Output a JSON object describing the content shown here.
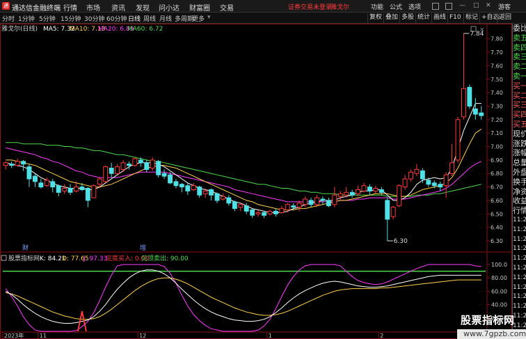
{
  "titlebar": {
    "app_name": "通达信金融终端",
    "menus": [
      "行情",
      "市场",
      "资讯",
      "发现",
      "问小达",
      "财富圈",
      "交易"
    ],
    "notice": "证券交易未登录",
    "stock_link": "雅戈尔",
    "right_items": [
      "功能",
      "公式",
      "选项"
    ],
    "guest": "游客"
  },
  "toolbar": {
    "periods": [
      "分时",
      "1分钟",
      "5分钟",
      "15分钟",
      "30分钟",
      "60分钟",
      "日线",
      "周线",
      "月线",
      "多周期",
      "更多"
    ],
    "active_period": "日线",
    "right_buttons": [
      "复权",
      "叠加",
      "多股",
      "统计",
      "画线",
      "F10",
      "标记",
      "+自选",
      "返回"
    ]
  },
  "main_panel": {
    "stock_label": "雅戈尔(日线)",
    "ma": [
      {
        "label": "MA5: 7.32",
        "color": "#ffffff"
      },
      {
        "label": "MA10: 7.13",
        "color": "#ffd24a"
      },
      {
        "label": "MA20: 6.89",
        "color": "#ff3cff"
      },
      {
        "label": "MA60: 6.72",
        "color": "#4fdc4f"
      }
    ],
    "price_ticks": [
      "7.80",
      "7.70",
      "7.60",
      "7.50",
      "7.40",
      "7.30",
      "7.20",
      "7.10",
      "7.00",
      "6.90",
      "6.80",
      "6.70",
      "6.60",
      "6.50",
      "6.40",
      "6.30"
    ],
    "high_label": "7.84",
    "low_label": "6.30",
    "markers": [
      "财",
      "增"
    ]
  },
  "indicator_panel": {
    "name": "股票指标网",
    "values": [
      {
        "label": "K: 84.21",
        "color": "#ffffff"
      },
      {
        "label": "D: 77.65",
        "color": "#ffd24a"
      },
      {
        "label": "J: 97.33",
        "color": "#ff3cff"
      },
      {
        "label": "见底买入: 0.00",
        "color": "#ff3a3a"
      },
      {
        "label": "见顶卖出: 90.00",
        "color": "#4fdc4f"
      }
    ],
    "ticks": [
      "100.0",
      "80.00",
      "60.00",
      "40.00",
      "20.00"
    ]
  },
  "date_axis": [
    "2023年",
    "11",
    "12",
    "1",
    "2"
  ],
  "side_panel": {
    "items": [
      "委比",
      "卖五",
      "卖四",
      "卖三",
      "卖二",
      "卖一",
      "买一",
      "买二",
      "买三",
      "买四",
      "买五",
      "现价",
      "涨跌",
      "涨幅",
      "总量",
      "外盘",
      "换手",
      "净资",
      "收益",
      "行情"
    ],
    "clocks": [
      "11:25",
      "11:25",
      "11:25",
      "11:25",
      "11:25",
      "11:25",
      "11:25",
      "11:25",
      "11:25",
      "11:25",
      "11:25",
      "11:25"
    ]
  },
  "watermark": {
    "title": "股票指标网",
    "url": "www.7gpzb.com"
  },
  "colors": {
    "up": "#ff3a3a",
    "down": "#4fe0e6",
    "ma5": "#ffffff",
    "ma10": "#ffd24a",
    "ma20": "#ff3cff",
    "ma60": "#4fdc4f",
    "grid": "#8b1010"
  },
  "chart_data": {
    "type": "candlestick",
    "price_axis": {
      "min": 6.3,
      "max": 7.84
    },
    "indicator_axis": {
      "min": 0,
      "max": 100,
      "ticks": [
        100,
        80,
        60,
        40,
        20
      ]
    },
    "candles": [
      [
        6.86,
        6.88,
        6.83,
        6.89
      ],
      [
        6.87,
        6.86,
        6.84,
        6.89
      ],
      [
        6.86,
        6.89,
        6.85,
        6.91
      ],
      [
        6.89,
        6.87,
        6.82,
        6.9
      ],
      [
        6.85,
        6.76,
        6.7,
        6.87
      ],
      [
        6.78,
        6.74,
        6.7,
        6.8
      ],
      [
        6.73,
        6.7,
        6.69,
        6.76
      ],
      [
        6.71,
        6.75,
        6.7,
        6.77
      ],
      [
        6.74,
        6.7,
        6.66,
        6.76
      ],
      [
        6.71,
        6.66,
        6.63,
        6.72
      ],
      [
        6.67,
        6.69,
        6.65,
        6.72
      ],
      [
        6.69,
        6.66,
        6.64,
        6.72
      ],
      [
        6.67,
        6.7,
        6.66,
        6.74
      ],
      [
        6.7,
        6.68,
        6.67,
        6.73
      ],
      [
        6.69,
        6.6,
        6.55,
        6.7
      ],
      [
        6.62,
        6.71,
        6.62,
        6.72
      ],
      [
        6.72,
        6.76,
        6.69,
        6.77
      ],
      [
        6.74,
        6.85,
        6.73,
        6.86
      ],
      [
        6.84,
        6.8,
        6.77,
        6.88
      ],
      [
        6.8,
        6.85,
        6.79,
        6.87
      ],
      [
        6.83,
        6.88,
        6.81,
        6.9
      ],
      [
        6.87,
        6.86,
        6.83,
        6.89
      ],
      [
        6.86,
        6.91,
        6.85,
        6.92
      ],
      [
        6.9,
        6.88,
        6.85,
        6.92
      ],
      [
        6.88,
        6.83,
        6.81,
        6.9
      ],
      [
        6.84,
        6.9,
        6.82,
        6.92
      ],
      [
        6.89,
        6.79,
        6.77,
        6.9
      ],
      [
        6.8,
        6.78,
        6.76,
        6.83
      ],
      [
        6.79,
        6.73,
        6.72,
        6.81
      ],
      [
        6.74,
        6.71,
        6.69,
        6.76
      ],
      [
        6.72,
        6.7,
        6.66,
        6.73
      ],
      [
        6.71,
        6.67,
        6.64,
        6.73
      ],
      [
        6.68,
        6.71,
        6.67,
        6.73
      ],
      [
        6.7,
        6.64,
        6.62,
        6.71
      ],
      [
        6.65,
        6.67,
        6.62,
        6.69
      ],
      [
        6.68,
        6.64,
        6.6,
        6.69
      ],
      [
        6.65,
        6.6,
        6.58,
        6.66
      ],
      [
        6.61,
        6.63,
        6.6,
        6.65
      ],
      [
        6.62,
        6.58,
        6.56,
        6.64
      ],
      [
        6.59,
        6.54,
        6.52,
        6.6
      ],
      [
        6.55,
        6.57,
        6.52,
        6.58
      ],
      [
        6.56,
        6.52,
        6.5,
        6.58
      ],
      [
        6.53,
        6.49,
        6.47,
        6.54
      ],
      [
        6.5,
        6.51,
        6.48,
        6.53
      ],
      [
        6.51,
        6.49,
        6.47,
        6.52
      ],
      [
        6.5,
        6.52,
        6.49,
        6.53
      ],
      [
        6.52,
        6.5,
        6.48,
        6.54
      ],
      [
        6.51,
        6.54,
        6.5,
        6.56
      ],
      [
        6.53,
        6.57,
        6.51,
        6.58
      ],
      [
        6.56,
        6.55,
        6.53,
        6.58
      ],
      [
        6.55,
        6.58,
        6.52,
        6.6
      ],
      [
        6.57,
        6.61,
        6.55,
        6.63
      ],
      [
        6.6,
        6.57,
        6.55,
        6.62
      ],
      [
        6.57,
        6.62,
        6.55,
        6.64
      ],
      [
        6.61,
        6.6,
        6.57,
        6.63
      ],
      [
        6.6,
        6.56,
        6.55,
        6.62
      ],
      [
        6.57,
        6.64,
        6.55,
        6.7
      ],
      [
        6.63,
        6.65,
        6.6,
        6.67
      ],
      [
        6.64,
        6.66,
        6.62,
        6.7
      ],
      [
        6.66,
        6.64,
        6.62,
        6.68
      ],
      [
        6.65,
        6.68,
        6.63,
        6.71
      ],
      [
        6.67,
        6.71,
        6.66,
        6.73
      ],
      [
        6.7,
        6.67,
        6.64,
        6.72
      ],
      [
        6.67,
        6.69,
        6.65,
        6.71
      ],
      [
        6.68,
        6.66,
        6.64,
        6.7
      ],
      [
        6.6,
        6.46,
        6.3,
        6.62
      ],
      [
        6.48,
        6.55,
        6.46,
        6.56
      ],
      [
        6.56,
        6.71,
        6.55,
        6.72
      ],
      [
        6.7,
        6.76,
        6.68,
        6.79
      ],
      [
        6.76,
        6.81,
        6.74,
        6.83
      ],
      [
        6.8,
        6.83,
        6.78,
        6.87
      ],
      [
        6.82,
        6.76,
        6.73,
        6.84
      ],
      [
        6.75,
        6.72,
        6.7,
        6.77
      ],
      [
        6.73,
        6.71,
        6.69,
        6.75
      ],
      [
        6.72,
        6.7,
        6.67,
        6.74
      ],
      [
        6.71,
        6.79,
        6.62,
        6.81
      ],
      [
        6.8,
        6.88,
        6.78,
        7.02
      ],
      [
        6.9,
        7.2,
        6.88,
        7.22
      ],
      [
        7.22,
        7.43,
        7.2,
        7.84
      ],
      [
        7.44,
        7.3,
        7.28,
        7.46
      ],
      [
        7.28,
        7.24,
        7.2,
        7.36
      ],
      [
        7.25,
        7.23,
        7.2,
        7.3
      ]
    ],
    "ma5": [
      6.88,
      6.87,
      6.86,
      6.85,
      6.83,
      6.8,
      6.77,
      6.75,
      6.73,
      6.71,
      6.7,
      6.69,
      6.69,
      6.69,
      6.68,
      6.68,
      6.7,
      6.73,
      6.76,
      6.79,
      6.82,
      6.85,
      6.87,
      6.88,
      6.88,
      6.88,
      6.87,
      6.85,
      6.82,
      6.79,
      6.76,
      6.73,
      6.71,
      6.69,
      6.68,
      6.67,
      6.65,
      6.63,
      6.61,
      6.59,
      6.58,
      6.56,
      6.54,
      6.53,
      6.52,
      6.51,
      6.51,
      6.51,
      6.52,
      6.54,
      6.55,
      6.57,
      6.58,
      6.59,
      6.6,
      6.6,
      6.6,
      6.62,
      6.63,
      6.64,
      6.66,
      6.67,
      6.67,
      6.68,
      6.68,
      6.64,
      6.6,
      6.6,
      6.62,
      6.66,
      6.72,
      6.75,
      6.76,
      6.77,
      6.76,
      6.77,
      6.84,
      6.98,
      7.12,
      7.22,
      7.32,
      7.32
    ],
    "ma10": [
      6.9,
      6.9,
      6.89,
      6.88,
      6.87,
      6.86,
      6.84,
      6.82,
      6.8,
      6.78,
      6.76,
      6.74,
      6.73,
      6.72,
      6.71,
      6.7,
      6.7,
      6.71,
      6.72,
      6.74,
      6.76,
      6.78,
      6.8,
      6.82,
      6.84,
      6.85,
      6.86,
      6.86,
      6.85,
      6.84,
      6.82,
      6.8,
      6.78,
      6.76,
      6.74,
      6.72,
      6.7,
      6.68,
      6.66,
      6.64,
      6.62,
      6.6,
      6.59,
      6.57,
      6.56,
      6.55,
      6.54,
      6.53,
      6.53,
      6.53,
      6.54,
      6.54,
      6.55,
      6.56,
      6.57,
      6.58,
      6.59,
      6.6,
      6.6,
      6.61,
      6.62,
      6.63,
      6.64,
      6.65,
      6.65,
      6.65,
      6.64,
      6.63,
      6.63,
      6.64,
      6.66,
      6.68,
      6.69,
      6.7,
      6.71,
      6.73,
      6.77,
      6.84,
      6.93,
      7.02,
      7.1,
      7.13
    ],
    "ma20": [
      6.99,
      6.98,
      6.97,
      6.96,
      6.95,
      6.94,
      6.92,
      6.91,
      6.89,
      6.88,
      6.86,
      6.84,
      6.82,
      6.81,
      6.79,
      6.78,
      6.77,
      6.77,
      6.77,
      6.77,
      6.78,
      6.79,
      6.8,
      6.81,
      6.81,
      6.81,
      6.81,
      6.81,
      6.8,
      6.79,
      6.78,
      6.77,
      6.76,
      6.75,
      6.74,
      6.73,
      6.72,
      6.71,
      6.7,
      6.68,
      6.67,
      6.66,
      6.65,
      6.64,
      6.63,
      6.62,
      6.61,
      6.6,
      6.59,
      6.59,
      6.59,
      6.59,
      6.59,
      6.59,
      6.59,
      6.59,
      6.59,
      6.6,
      6.6,
      6.6,
      6.61,
      6.61,
      6.62,
      6.62,
      6.62,
      6.62,
      6.61,
      6.61,
      6.61,
      6.62,
      6.63,
      6.64,
      6.65,
      6.66,
      6.67,
      6.69,
      6.72,
      6.76,
      6.8,
      6.84,
      6.87,
      6.89
    ],
    "ma60": [
      7.03,
      7.03,
      7.03,
      7.02,
      7.02,
      7.02,
      7.02,
      7.01,
      7.01,
      7.01,
      7.0,
      7.0,
      6.99,
      6.99,
      6.98,
      6.97,
      6.97,
      6.96,
      6.95,
      6.94,
      6.94,
      6.93,
      6.92,
      6.91,
      6.9,
      6.89,
      6.89,
      6.88,
      6.87,
      6.86,
      6.85,
      6.84,
      6.83,
      6.82,
      6.81,
      6.8,
      6.79,
      6.78,
      6.77,
      6.76,
      6.75,
      6.74,
      6.73,
      6.72,
      6.72,
      6.71,
      6.7,
      6.69,
      6.69,
      6.68,
      6.67,
      6.67,
      6.66,
      6.66,
      6.65,
      6.65,
      6.65,
      6.64,
      6.64,
      6.64,
      6.64,
      6.64,
      6.64,
      6.64,
      6.64,
      6.63,
      6.63,
      6.63,
      6.63,
      6.63,
      6.64,
      6.64,
      6.64,
      6.65,
      6.65,
      6.66,
      6.67,
      6.68,
      6.69,
      6.7,
      6.71,
      6.72
    ],
    "K": [
      60,
      55,
      48,
      40,
      33,
      27,
      22,
      18,
      15,
      13,
      12,
      12,
      13,
      15,
      17,
      22,
      30,
      40,
      52,
      63,
      72,
      80,
      86,
      90,
      92,
      92,
      90,
      86,
      80,
      72,
      63,
      55,
      47,
      40,
      34,
      29,
      25,
      22,
      19,
      17,
      16,
      15,
      15,
      16,
      18,
      22,
      28,
      35,
      43,
      50,
      56,
      61,
      65,
      69,
      72,
      74,
      75,
      74,
      72,
      70,
      68,
      67,
      66,
      66,
      67,
      68,
      70,
      72,
      74,
      76,
      78,
      80,
      82,
      83,
      84,
      84,
      84,
      84,
      84,
      84,
      84,
      84
    ],
    "D": [
      58,
      56,
      53,
      49,
      45,
      41,
      37,
      33,
      29,
      26,
      23,
      21,
      19,
      18,
      18,
      19,
      22,
      27,
      33,
      40,
      47,
      54,
      61,
      67,
      72,
      76,
      79,
      80,
      80,
      78,
      75,
      71,
      66,
      61,
      56,
      51,
      47,
      43,
      39,
      35,
      32,
      29,
      27,
      25,
      24,
      24,
      25,
      27,
      30,
      34,
      38,
      42,
      46,
      50,
      54,
      57,
      60,
      62,
      63,
      64,
      64,
      64,
      64,
      64,
      65,
      65,
      66,
      67,
      68,
      69,
      70,
      71,
      72,
      73,
      74,
      75,
      76,
      77,
      77,
      77,
      77,
      77
    ],
    "J": [
      64,
      52,
      38,
      22,
      10,
      2,
      0,
      0,
      0,
      0,
      0,
      0,
      1,
      7,
      15,
      28,
      46,
      66,
      84,
      98,
      100,
      100,
      100,
      100,
      100,
      100,
      100,
      97,
      87,
      72,
      54,
      38,
      25,
      16,
      9,
      4,
      2,
      0,
      0,
      0,
      0,
      0,
      0,
      2,
      8,
      18,
      34,
      52,
      69,
      82,
      92,
      98,
      100,
      100,
      100,
      100,
      100,
      98,
      90,
      82,
      76,
      73,
      71,
      70,
      71,
      74,
      78,
      82,
      86,
      90,
      94,
      97,
      100,
      100,
      100,
      100,
      100,
      100,
      100,
      100,
      98,
      97
    ],
    "buy_signal_index": 13,
    "sell_line": 90,
    "x_labels": [
      {
        "index": 0,
        "label": "2023年"
      },
      {
        "index": 6,
        "label": "11"
      },
      {
        "index": 23,
        "label": "12"
      },
      {
        "index": 45,
        "label": "1"
      },
      {
        "index": 64,
        "label": "2"
      }
    ]
  }
}
